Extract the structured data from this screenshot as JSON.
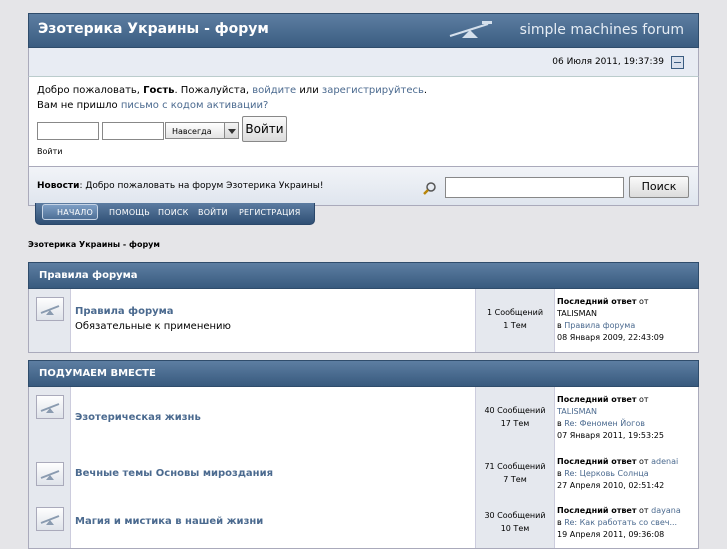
{
  "header": {
    "title": "Эзотерика Украины - форум",
    "brand": "simple machines forum"
  },
  "date": "06 Июля 2011, 19:37:39",
  "user": {
    "welcome": "Добро пожаловать,",
    "guest": "Гость",
    "please": ". Пожалуйста,",
    "login_link": "войдите",
    "or": "или",
    "register_link": "зарегистрируйтесь",
    "period": ".",
    "no_mail": "Вам не пришло",
    "activation_link": "письмо с кодом активации?",
    "duration": "Навсегда",
    "login_button": "Войти",
    "login_label": "Войти"
  },
  "news": {
    "label": "Новости",
    "text": ": Добро пожаловать на форум Эзотерика Украины!",
    "search_button": "Поиск"
  },
  "menu": [
    "НАЧАЛО",
    "ПОМОЩЬ",
    "ПОИСК",
    "ВОЙТИ",
    "РЕГИСТРАЦИЯ"
  ],
  "breadcrumb": "Эзотерика Украины - форум",
  "categories": [
    {
      "title": "Правила форума",
      "boards": [
        {
          "name": "Правила форума",
          "desc": "Обязательные к применению",
          "posts": "1 Сообщений",
          "topics": "1 Тем",
          "last_label": "Последний ответ",
          "by": "от",
          "author": "TALISMAN",
          "in": "в",
          "topic": "Правила форума",
          "date": "08 Января 2009, 22:43:09"
        }
      ]
    },
    {
      "title": "ПОДУМАЕМ ВМЕСТЕ",
      "boards": [
        {
          "name": "Эзотерическая жизнь",
          "desc": "",
          "posts": "40 Сообщений",
          "topics": "17 Тем",
          "last_label": "Последний ответ",
          "by": "от",
          "author": "TALISMAN",
          "in": "в",
          "topic": "Re: Феномен Йогов",
          "date": "07 Января 2011, 19:53:25"
        },
        {
          "name": "Вечные темы Основы мироздания",
          "desc": "",
          "posts": "71 Сообщений",
          "topics": "7 Тем",
          "last_label": "Последний ответ",
          "by": "от",
          "author": "adenai",
          "in": "в",
          "topic": "Re: Церковь Солнца",
          "date": "27 Апреля 2010, 02:51:42"
        },
        {
          "name": "Магия и мистика в нашей жизни",
          "desc": "",
          "posts": "30 Сообщений",
          "topics": "10 Тем",
          "last_label": "Последний ответ",
          "by": "от",
          "author": "dayana",
          "in": "в",
          "topic": "Re: Как работать со свеч...",
          "date": "19 Апреля 2011, 09:36:08"
        }
      ]
    }
  ],
  "colors": {
    "header": "#3a5c80",
    "link": "#4b6a8f",
    "background": "#e5e5e8"
  }
}
